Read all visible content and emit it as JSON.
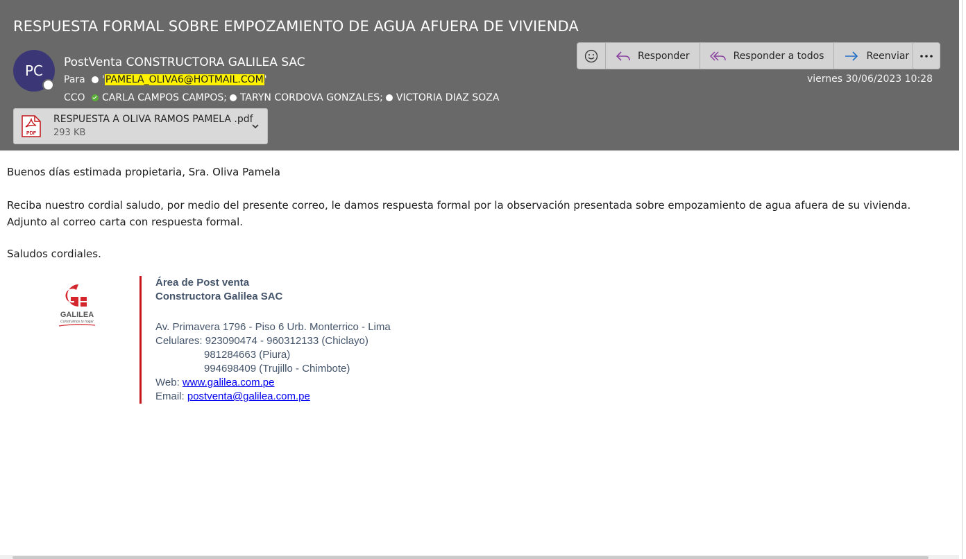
{
  "email": {
    "subject": "RESPUESTA FORMAL SOBRE EMPOZAMIENTO DE AGUA AFUERA DE VIVIENDA",
    "avatar_initials": "PC",
    "sender": "PostVenta CONSTRUCTORA GALILEA SAC",
    "to_label": "Para",
    "to_recipient": "PAMELA_OLIVA6@HOTMAIL.COM",
    "cc_label": "CCO",
    "cc_recipients": [
      "CARLA CAMPOS CAMPOS;",
      "TARYN CORDOVA GONZALES;",
      "VICTORIA DIAZ SOZA"
    ],
    "date": "viernes 30/06/2023 10:28"
  },
  "attachment": {
    "name": "RESPUESTA A OLIVA RAMOS PAMELA .pdf",
    "size": "293 KB",
    "icon": "pdf-file-icon",
    "icon_text": "PDF"
  },
  "toolbar": {
    "emoji_icon": "smiley-icon",
    "reply_label": "Responder",
    "reply_all_label": "Responder a todos",
    "forward_label": "Reenviar",
    "more_icon": "more-ellipsis-icon"
  },
  "body": {
    "greeting": "Buenos días estimada propietaria, Sra. Oliva Pamela",
    "paragraph_1": "Reciba nuestro cordial saludo, por medio del presente correo, le damos respuesta formal por la observación presentada sobre empozamiento de agua afuera de su vivienda.",
    "paragraph_2": "Adjunto al correo carta con respuesta formal.",
    "closing": "Saludos cordiales."
  },
  "signature": {
    "logo_text": "GALILEA",
    "logo_tagline": "Construimos tu hogar",
    "department": "Área de Post venta",
    "company": "Constructora Galilea SAC",
    "address": "Av. Primavera 1796 - Piso 6 Urb. Monterrico - Lima",
    "phones_label": "Celulares:",
    "phone_1": "923090474 - 960312133 (Chiclayo)",
    "phone_2": "981284663 (Piura)",
    "phone_3": "994698409 (Trujillo - Chimbote)",
    "web_label": "Web:",
    "web": "www.galilea.com.pe",
    "email_label": "Email:",
    "email": "postventa@galilea.com.pe"
  },
  "colors": {
    "header_bg": "#696969",
    "avatar_bg": "#3b3776",
    "highlight": "#fff200",
    "signature_accent": "#c4161c",
    "reply_icon": "#8a3f9e",
    "forward_icon": "#1f6fc5"
  }
}
